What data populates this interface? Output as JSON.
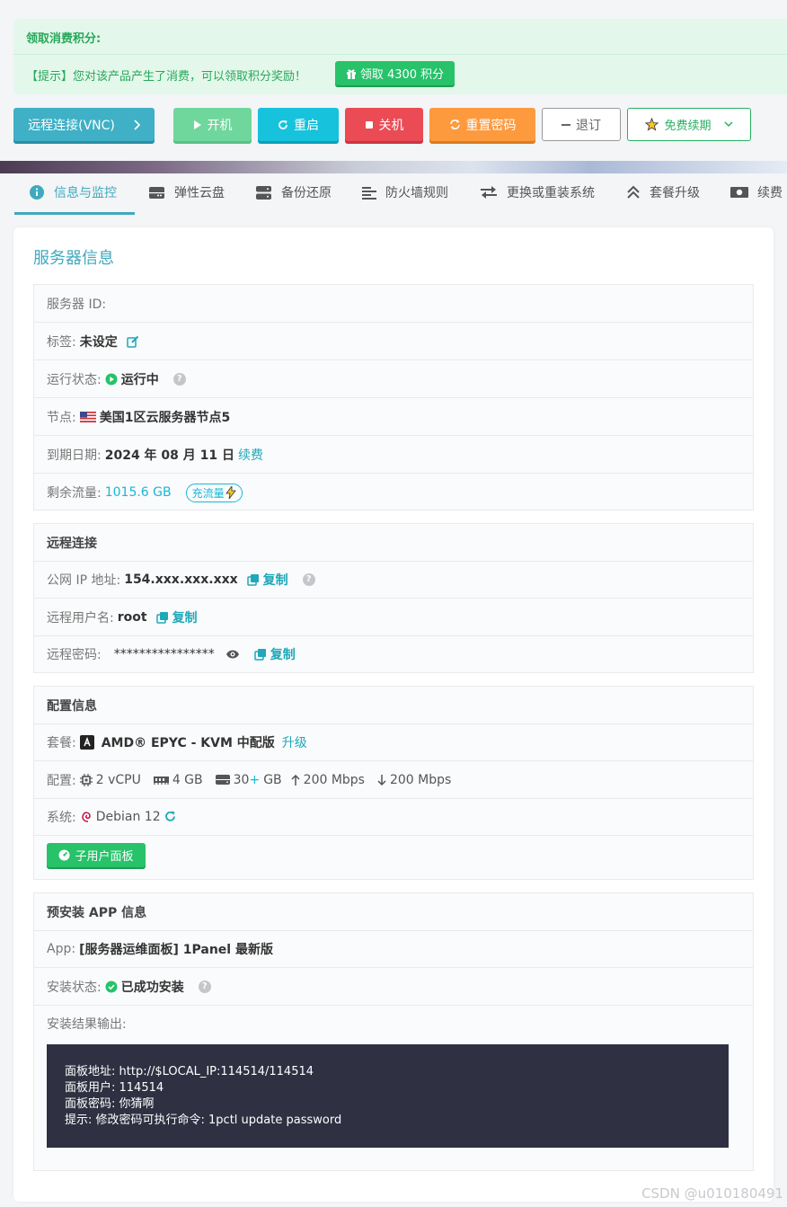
{
  "notice": {
    "title": "领取消费积分:",
    "text": "【提示】您对该产品产生了消费，可以领取积分奖励！",
    "claim_button": "领取 4300 积分"
  },
  "actions": {
    "vnc": "远程连接(VNC)",
    "power_on": "开机",
    "reboot": "重启",
    "power_off": "关机",
    "reset_password": "重置密码",
    "refund": "退订",
    "free_renew": "免费续期"
  },
  "tabs": [
    {
      "label": "信息与监控",
      "icon": "info-icon",
      "active": true
    },
    {
      "label": "弹性云盘",
      "icon": "disk-icon"
    },
    {
      "label": "备份还原",
      "icon": "server-icon"
    },
    {
      "label": "防火墙规则",
      "icon": "align-left-icon"
    },
    {
      "label": "更换或重装系统",
      "icon": "exchange-icon"
    },
    {
      "label": "套餐升级",
      "icon": "chevron-up-double-icon"
    },
    {
      "label": "续费",
      "icon": "money-icon"
    }
  ],
  "card_title": "服务器信息",
  "server": {
    "id_label": "服务器 ID:",
    "tag_label": "标签:",
    "tag_value": "未设定",
    "status_label": "运行状态:",
    "status_value": "运行中",
    "node_label": "节点:",
    "node_value": "美国1区云服务器节点5",
    "expire_label": "到期日期:",
    "expire_value": "2024 年 08 月 11 日",
    "renew_link": "续费",
    "traffic_label": "剩余流量:",
    "traffic_value": "1015.6 GB",
    "traffic_button": "充流量"
  },
  "remote": {
    "title": "远程连接",
    "ip_label": "公网 IP 地址:",
    "ip_value": "154.xxx.xxx.xxx",
    "copy": "复制",
    "user_label": "远程用户名:",
    "user_value": "root",
    "pass_label": "远程密码:",
    "pass_value": "****************"
  },
  "config": {
    "title": "配置信息",
    "plan_label": "套餐:",
    "plan_value": "AMD® EPYC - KVM 中配版",
    "upgrade_link": "升级",
    "spec_label": "配置:",
    "cpu": "2 vCPU",
    "ram": "4 GB",
    "disk_a": "30",
    "disk_plus": "+",
    "disk_b": "GB",
    "up": "200 Mbps",
    "down": "200 Mbps",
    "os_label": "系统:",
    "os_value": "Debian 12",
    "sub_panel_button": "子用户面板"
  },
  "app": {
    "title": "预安装 APP 信息",
    "app_label": "App:",
    "app_value": "[服务器运维面板] 1Panel 最新版",
    "install_label": "安装状态:",
    "install_value": "已成功安装",
    "output_label": "安装结果输出:",
    "output_lines": [
      "面板地址: http://$LOCAL_IP:114514/114514",
      "面板用户: 114514",
      "面板密码: 你猜啊",
      "提示: 修改密码可执行命令: 1pctl update password"
    ]
  },
  "watermark": "CSDN @u010180491",
  "colors": {
    "accent": "#3fa9bd",
    "green": "#27c26a",
    "red": "#ea4b55",
    "orange": "#fd9a3e",
    "cyan": "#16c2dc"
  }
}
